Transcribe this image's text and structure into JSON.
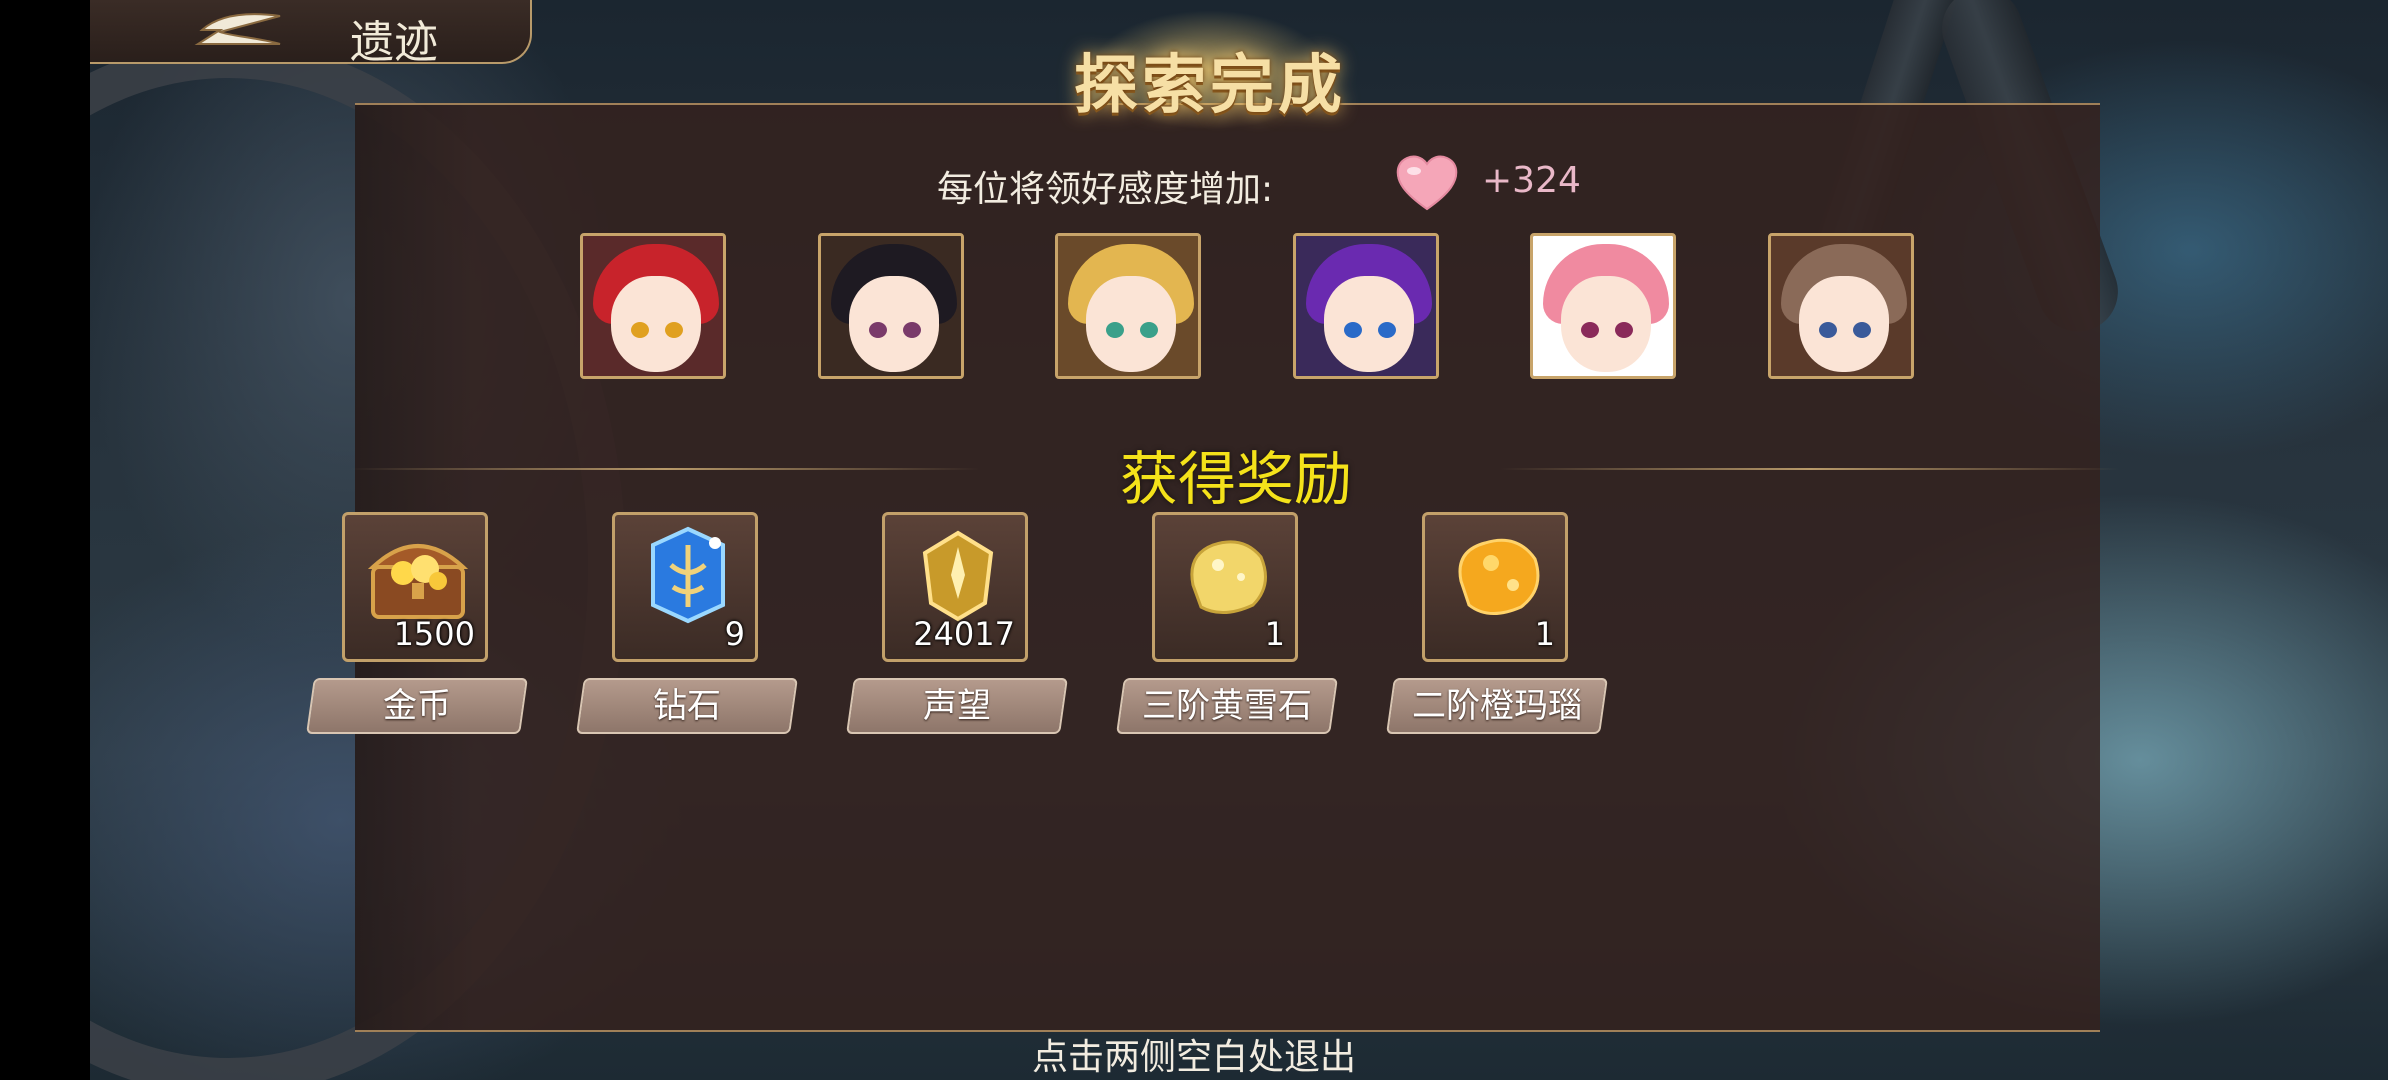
{
  "header": {
    "title": "遗迹"
  },
  "result": {
    "title": "探索完成"
  },
  "affection": {
    "label": "每位将领好感度增加:",
    "value": "+324",
    "icon": "heart-icon",
    "heart_color": "#f5a6b8"
  },
  "portraits": [
    {
      "name": "red-hair-headset",
      "hair": "#c8232b",
      "bg": "#5a2a2a",
      "eye": "#e0a020"
    },
    {
      "name": "dark-hair-cap",
      "hair": "#1e1a22",
      "bg": "#3a2a22",
      "eye": "#7a3a6a"
    },
    {
      "name": "blonde-hair",
      "hair": "#e3b650",
      "bg": "#6a4a2a",
      "eye": "#3aa08a"
    },
    {
      "name": "purple-hair",
      "hair": "#6a2ab0",
      "bg": "#3a2a5a",
      "eye": "#2a6ac8"
    },
    {
      "name": "pink-hair-hat",
      "hair": "#f08aa0",
      "bg": "#ffffff",
      "eye": "#8a2a5a"
    },
    {
      "name": "brown-hair-mask",
      "hair": "#8a6a58",
      "bg": "#5a3a2a",
      "eye": "#3a5a9a"
    }
  ],
  "rewards": {
    "title": "获得奖励",
    "items": [
      {
        "count": "1500",
        "label": "金币",
        "icon": "treasure-chest-icon"
      },
      {
        "count": "9",
        "label": "钻石",
        "icon": "blue-crystal-icon"
      },
      {
        "count": "24017",
        "label": "声望",
        "icon": "gold-badge-icon"
      },
      {
        "count": "1",
        "label": "三阶黄雪石",
        "icon": "yellow-stone-icon"
      },
      {
        "count": "1",
        "label": "二阶橙玛瑙",
        "icon": "orange-agate-icon"
      }
    ]
  },
  "footer": {
    "hint": "点击两侧空白处退出"
  },
  "colors": {
    "accent_gold": "#c8a46a",
    "reward_title": "#f4e21a",
    "panel_bg": "#34221e"
  }
}
